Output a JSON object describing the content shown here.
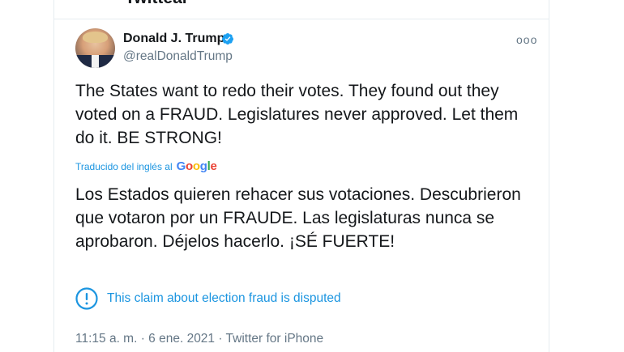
{
  "header": {
    "title": "Twittear"
  },
  "tweet": {
    "author_name": "Donald J. Trump",
    "author_handle": "@realDonaldTrump",
    "more_label": "ooo",
    "text": "The States want to redo their votes. They found out they voted on a FRAUD. Legislatures never approved. Let them do it. BE STRONG!",
    "translated_label": "Traducido del inglés al",
    "translator": "Google",
    "translation": "Los Estados quieren rehacer sus votaciones. Descubrieron que votaron por un FRAUDE. Las legislaturas nunca se aprobaron. Déjelos hacerlo. ¡SÉ FUERTE!",
    "disputed_notice": "This claim about election fraud is disputed",
    "timestamp": "11:15 a. m. · 6 ene. 2021 · Twitter for iPhone"
  },
  "colors": {
    "accent": "#1b95e0",
    "verified": "#1da1f2",
    "secondary_text": "#657786",
    "google_blue": "#4285f4",
    "google_red": "#ea4335",
    "google_yellow": "#fbbc05",
    "google_green": "#34a853"
  },
  "icons": {
    "verified": "verified-badge-icon",
    "info": "info-circle-icon",
    "more": "more-horizontal-icon"
  }
}
